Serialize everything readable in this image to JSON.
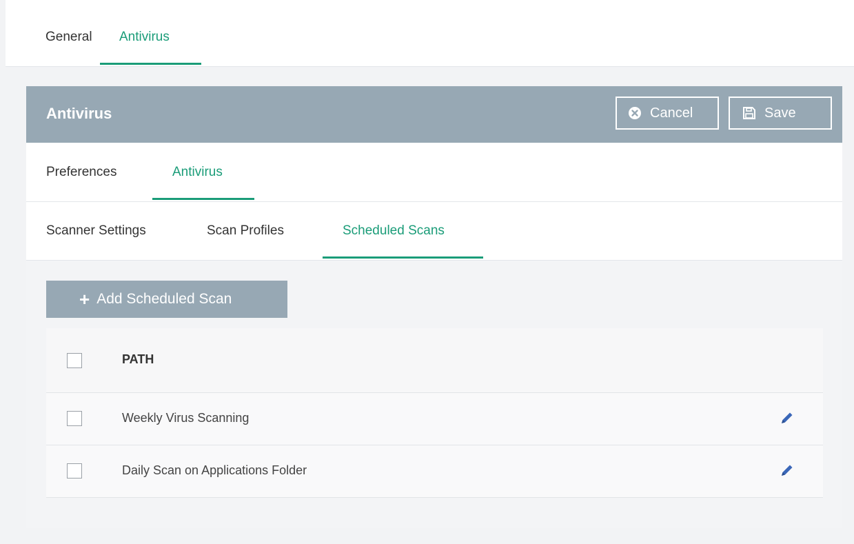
{
  "top_tabs": [
    {
      "label": "General"
    },
    {
      "label": "Antivirus"
    }
  ],
  "panel": {
    "title": "Antivirus",
    "cancel_label": "Cancel",
    "save_label": "Save"
  },
  "pref_tabs": [
    {
      "label": "Preferences"
    },
    {
      "label": "Antivirus"
    }
  ],
  "sub_tabs": [
    {
      "label": "Scanner Settings"
    },
    {
      "label": "Scan Profiles"
    },
    {
      "label": "Scheduled Scans"
    }
  ],
  "add_button_label": "Add Scheduled Scan",
  "table": {
    "header": "PATH",
    "rows": [
      {
        "path": "Weekly Virus Scanning"
      },
      {
        "path": "Daily Scan on Applications Folder"
      }
    ]
  },
  "colors": {
    "accent": "#1a9c78",
    "header_bg": "#97a8b4",
    "edit_icon": "#3a67b8"
  },
  "icons": {
    "cancel": "circle-x-icon",
    "save": "floppy-disk-icon",
    "add": "plus-icon",
    "edit": "pencil-icon"
  }
}
